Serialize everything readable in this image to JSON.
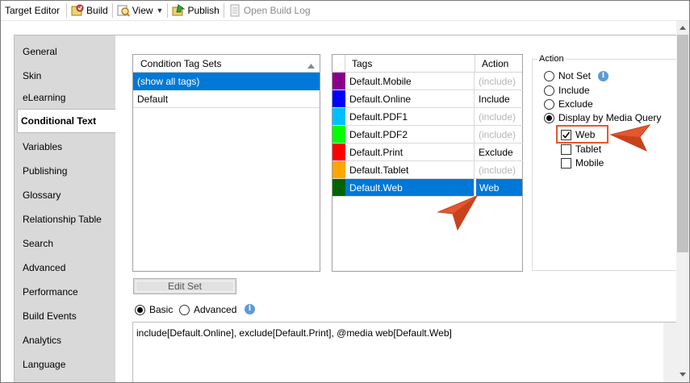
{
  "toolbar": {
    "title": "Target Editor",
    "build": "Build",
    "view": "View",
    "publish": "Publish",
    "open_build_log": "Open Build Log"
  },
  "sidebar": {
    "items": [
      "General",
      "Skin",
      "eLearning",
      "Conditional Text",
      "Variables",
      "Publishing",
      "Glossary",
      "Relationship Table",
      "Search",
      "Advanced",
      "Performance",
      "Build Events",
      "Analytics",
      "Language"
    ],
    "active": "Conditional Text"
  },
  "tagsets": {
    "header": "Condition Tag Sets",
    "items": [
      "(show all tags)",
      "Default"
    ],
    "selected_index": 0
  },
  "tags": {
    "header_name": "Tags",
    "header_action": "Action",
    "rows": [
      {
        "name": "Default.Mobile",
        "action": "(include)",
        "color": "#8b008b",
        "muted": true
      },
      {
        "name": "Default.Online",
        "action": "Include",
        "color": "#0000ff",
        "muted": false
      },
      {
        "name": "Default.PDF1",
        "action": "(include)",
        "color": "#00bfff",
        "muted": true
      },
      {
        "name": "Default.PDF2",
        "action": "(include)",
        "color": "#00ff00",
        "muted": true
      },
      {
        "name": "Default.Print",
        "action": "Exclude",
        "color": "#ff0000",
        "muted": false
      },
      {
        "name": "Default.Tablet",
        "action": "(include)",
        "color": "#ffa500",
        "muted": true
      },
      {
        "name": "Default.Web",
        "action": "Web",
        "color": "#006400",
        "muted": false
      }
    ],
    "selected_index": 6
  },
  "action": {
    "legend": "Action",
    "options": [
      "Not Set",
      "Include",
      "Exclude",
      "Display by Media Query"
    ],
    "selected": "Display by Media Query",
    "media": [
      {
        "label": "Web",
        "checked": true
      },
      {
        "label": "Tablet",
        "checked": false
      },
      {
        "label": "Mobile",
        "checked": false
      }
    ]
  },
  "edit_set": "Edit Set",
  "mode": {
    "basic": "Basic",
    "advanced": "Advanced",
    "selected": "Basic"
  },
  "expression": "include[Default.Online], exclude[Default.Print], @media web[Default.Web]",
  "colors": {
    "selection": "#0078d7",
    "callout": "#e4572e",
    "sidebar": "#d9d9d9",
    "info": "#5b9bd5"
  },
  "icons": [
    "build-icon",
    "view-icon",
    "publish-icon",
    "open-build-log-icon",
    "info-icon",
    "sort-up-icon",
    "check-icon",
    "arrow-pointer-icon"
  ]
}
